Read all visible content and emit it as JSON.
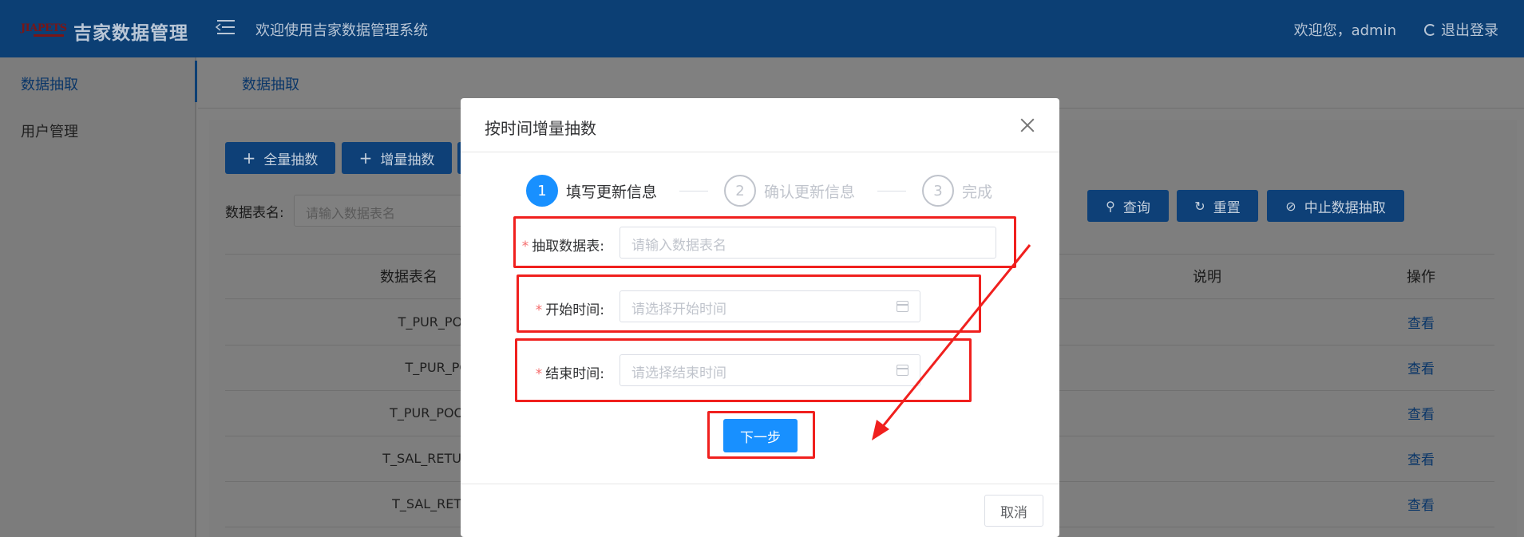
{
  "header": {
    "logo_mark": "JIAPETS",
    "app_title": "吉家数据管理",
    "welcome_text": "欢迎使用吉家数据管理系统",
    "user_text": "欢迎您，admin",
    "logout_label": "退出登录"
  },
  "sidebar": {
    "items": [
      {
        "label": "数据抽取",
        "active": true
      },
      {
        "label": "用户管理",
        "active": false
      }
    ]
  },
  "main": {
    "tab_label": "数据抽取",
    "toolbar": {
      "full_extract_label": "全量抽数",
      "incremental_extract_label": "增量抽数"
    },
    "filter": {
      "table_name_label": "数据表名:",
      "table_name_placeholder": "请输入数据表名"
    },
    "actions": {
      "query_label": "查询",
      "reset_label": "重置",
      "stop_label": "中止数据抽取"
    },
    "table": {
      "columns": [
        "数据表名",
        "说明",
        "操作"
      ],
      "rows": [
        {
          "name": "T_PUR_POORDE",
          "action": "查看"
        },
        {
          "name": "T_PUR_POORI",
          "action": "查看"
        },
        {
          "name": "T_PUR_POORDERE",
          "action": "查看"
        },
        {
          "name": "T_SAL_RETURNSTOC",
          "action": "查看"
        },
        {
          "name": "T_SAL_RETURNST",
          "action": "查看"
        }
      ]
    }
  },
  "modal": {
    "title": "按时间增量抽数",
    "steps": [
      {
        "number": "1",
        "label": "填写更新信息",
        "active": true
      },
      {
        "number": "2",
        "label": "确认更新信息",
        "active": false
      },
      {
        "number": "3",
        "label": "完成",
        "active": false
      }
    ],
    "fields": {
      "table": {
        "label": "抽取数据表:",
        "placeholder": "请输入数据表名",
        "required_mark": "*"
      },
      "start_time": {
        "label": "开始时间:",
        "placeholder": "请选择开始时间",
        "required_mark": "*"
      },
      "end_time": {
        "label": "结束时间:",
        "placeholder": "请选择结束时间",
        "required_mark": "*"
      }
    },
    "next_label": "下一步",
    "cancel_label": "取消"
  },
  "colors": {
    "header_bg": "#0c3f74",
    "primary": "#1890ff",
    "annotation_red": "#f0201e",
    "required": "#f56c6c"
  },
  "icons": {
    "menu": "menu-fold-icon",
    "logout": "logout-icon",
    "plus": "plus-icon",
    "search": "search-icon",
    "reset": "refresh-icon",
    "stop": "stop-icon",
    "close": "close-icon",
    "calendar": "calendar-icon"
  }
}
